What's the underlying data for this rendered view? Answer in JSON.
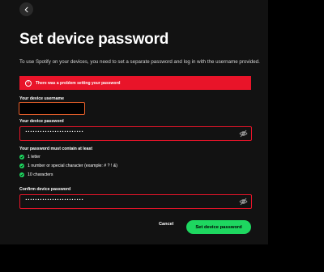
{
  "header": {
    "back_icon": "chevron-left-icon",
    "title": "Set device password"
  },
  "intro_text": "To use Spotify on your devices, you need to set a separate password and log in with the username provided.",
  "error": {
    "icon": "exclamation-circle-icon",
    "message": "There was a problem setting your password",
    "color": "#e91429"
  },
  "username": {
    "label": "Your device username",
    "value": ""
  },
  "password": {
    "label": "Your device password",
    "masked_value": "••••••••••••••••••••••••",
    "visibility_icon": "eye-off-icon"
  },
  "requirements": {
    "title": "Your password must contain at least",
    "items": [
      {
        "text": "1 letter",
        "icon": "check-circle-icon"
      },
      {
        "text": "1 number or special character (example: # ? ! &)",
        "icon": "check-circle-icon"
      },
      {
        "text": "10 characters",
        "icon": "check-circle-icon"
      }
    ]
  },
  "confirm_password": {
    "label": "Confirm device password",
    "masked_value": "••••••••••••••••••••••••",
    "visibility_icon": "eye-off-icon"
  },
  "actions": {
    "cancel_label": "Cancel",
    "submit_label": "Set device password"
  },
  "colors": {
    "accent": "#1ed760",
    "error": "#e91429",
    "focus_outline": "#e8602a",
    "background": "#121212"
  }
}
